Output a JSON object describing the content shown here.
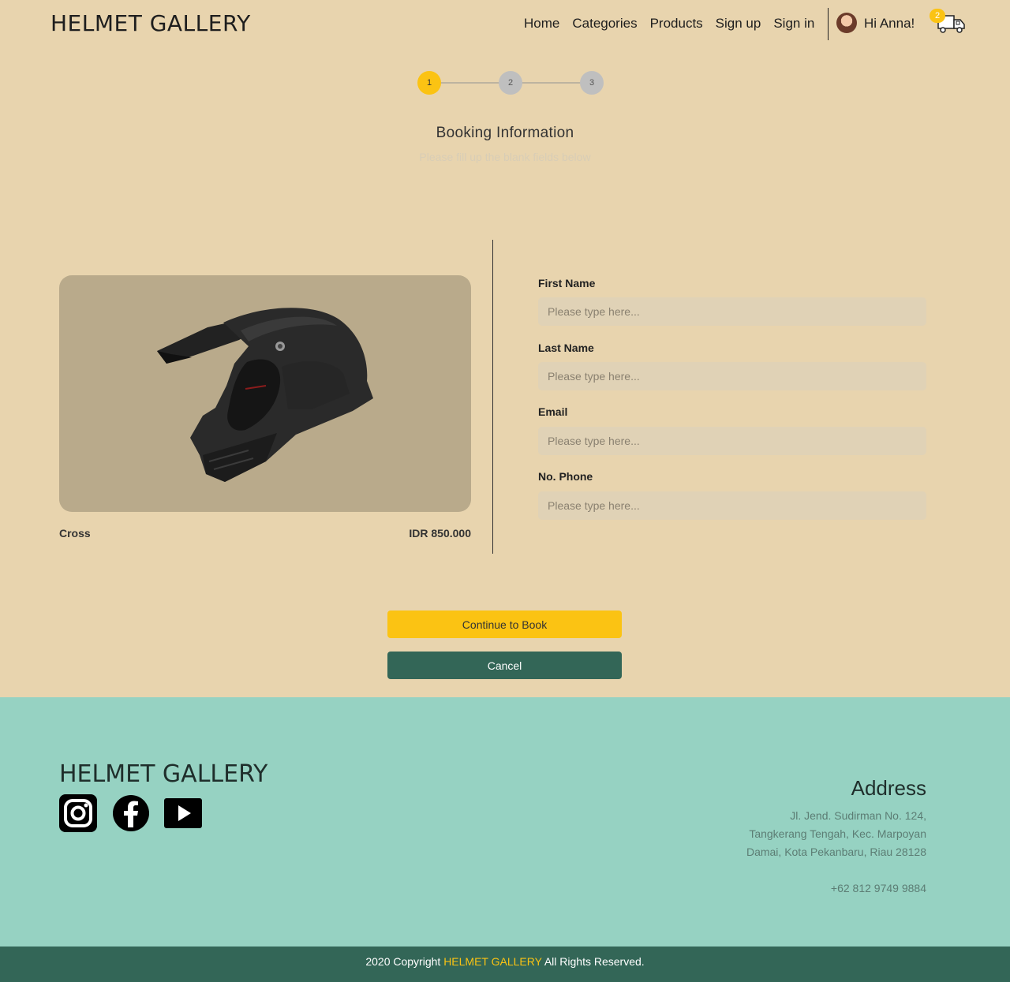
{
  "nav": {
    "brand": "HELMET GALLERY",
    "links": [
      "Home",
      "Categories",
      "Products",
      "Sign up",
      "Sign in"
    ],
    "greeting": "Hi Anna!",
    "cart_count": "2"
  },
  "stepper": {
    "steps": [
      "1",
      "2",
      "3"
    ],
    "current": 1
  },
  "page": {
    "title": "Booking Information",
    "subtitle": "Please fill up the blank fields below"
  },
  "product": {
    "name": "Cross",
    "price": "IDR 850.000"
  },
  "form": {
    "first_name_label": "First Name",
    "last_name_label": "Last Name",
    "email_label": "Email",
    "phone_label": "No. Phone",
    "placeholder": "Please type here..."
  },
  "actions": {
    "continue": "Continue to Book",
    "cancel": "Cancel"
  },
  "footer": {
    "brand": "HELMET GALLERY",
    "address_title": "Address",
    "address_line1": "Jl. Jend. Sudirman No. 124,",
    "address_line2": "Tangkerang Tengah, Kec. Marpoyan",
    "address_line3": "Damai, Kota Pekanbaru, Riau 28128",
    "phone": "+62 812 9749 9884"
  },
  "copyright": {
    "prefix": "2020 Copyright",
    "brand": "HELMET GALLERY",
    "suffix": "All Rights Reserved."
  },
  "colors": {
    "background": "#e8d4ae",
    "accent": "#fbc313",
    "dark_green": "#336657",
    "footer": "#96d2c2"
  }
}
